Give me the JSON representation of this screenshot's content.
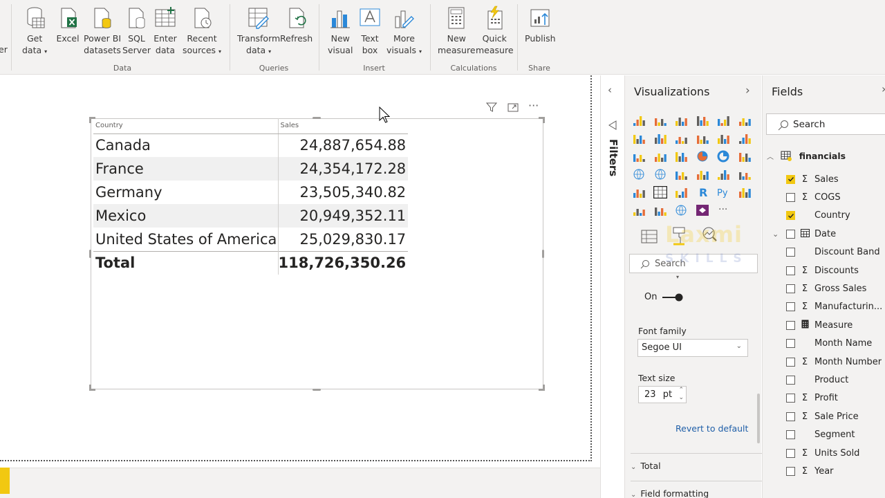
{
  "ribbon": {
    "cut_label": "er",
    "groups": {
      "data": "Data",
      "queries": "Queries",
      "insert": "Insert",
      "calculations": "Calculations",
      "share": "Share"
    },
    "buttons": {
      "get_data": [
        "Get",
        "data"
      ],
      "excel": [
        "Excel"
      ],
      "pbi_datasets": [
        "Power BI",
        "datasets"
      ],
      "sql_server": [
        "SQL",
        "Server"
      ],
      "enter_data": [
        "Enter",
        "data"
      ],
      "recent_sources": [
        "Recent",
        "sources"
      ],
      "transform_data": [
        "Transform",
        "data"
      ],
      "refresh": [
        "Refresh"
      ],
      "new_visual": [
        "New",
        "visual"
      ],
      "text_box": [
        "Text",
        "box"
      ],
      "more_visuals": [
        "More",
        "visuals"
      ],
      "new_measure": [
        "New",
        "measure"
      ],
      "quick_measure": [
        "Quick",
        "measure"
      ],
      "publish": [
        "Publish"
      ]
    }
  },
  "table_visual": {
    "headers": [
      "Country",
      "Sales"
    ],
    "rows": [
      {
        "country": "Canada",
        "sales": "24,887,654.88"
      },
      {
        "country": "France",
        "sales": "24,354,172.28"
      },
      {
        "country": "Germany",
        "sales": "23,505,340.82"
      },
      {
        "country": "Mexico",
        "sales": "20,949,352.11"
      },
      {
        "country": "United States of America",
        "sales": "25,029,830.17"
      }
    ],
    "total": {
      "label": "Total",
      "value": "118,726,350.26"
    }
  },
  "filters_pane": {
    "label": "Filters"
  },
  "visualizations_pane": {
    "title": "Visualizations",
    "search_placeholder": "Search",
    "toggle_label": "On",
    "font_family_label": "Font family",
    "font_family_value": "Segoe UI",
    "text_size_label": "Text size",
    "text_size_value": "23",
    "text_size_unit": "pt",
    "revert_label": "Revert to default",
    "sections": [
      "Total",
      "Field formatting"
    ],
    "watermark_top": "Laxmi",
    "watermark_bottom": "SKILLS"
  },
  "fields_pane": {
    "title": "Fields",
    "search_placeholder": "Search",
    "table_name": "financials",
    "fields": [
      {
        "name": "Sales",
        "sigma": true,
        "checked": true
      },
      {
        "name": "COGS",
        "sigma": true,
        "checked": false
      },
      {
        "name": "Country",
        "sigma": false,
        "checked": true
      },
      {
        "name": "Date",
        "sigma": false,
        "checked": false
      },
      {
        "name": "Discount Band",
        "sigma": false,
        "checked": false
      },
      {
        "name": "Discounts",
        "sigma": true,
        "checked": false
      },
      {
        "name": "Gross Sales",
        "sigma": true,
        "checked": false
      },
      {
        "name": "Manufacturin...",
        "sigma": true,
        "checked": false
      },
      {
        "name": "Measure",
        "sigma": false,
        "checked": false
      },
      {
        "name": "Month Name",
        "sigma": false,
        "checked": false
      },
      {
        "name": "Month Number",
        "sigma": true,
        "checked": false
      },
      {
        "name": "Product",
        "sigma": false,
        "checked": false
      },
      {
        "name": "Profit",
        "sigma": true,
        "checked": false
      },
      {
        "name": "Sale Price",
        "sigma": true,
        "checked": false
      },
      {
        "name": "Segment",
        "sigma": false,
        "checked": false
      },
      {
        "name": "Units Sold",
        "sigma": true,
        "checked": false
      },
      {
        "name": "Year",
        "sigma": true,
        "checked": false
      }
    ]
  },
  "colors": {
    "accent": "#f2c811",
    "link": "#1f5fa8",
    "pane": "#f3f2f1"
  }
}
